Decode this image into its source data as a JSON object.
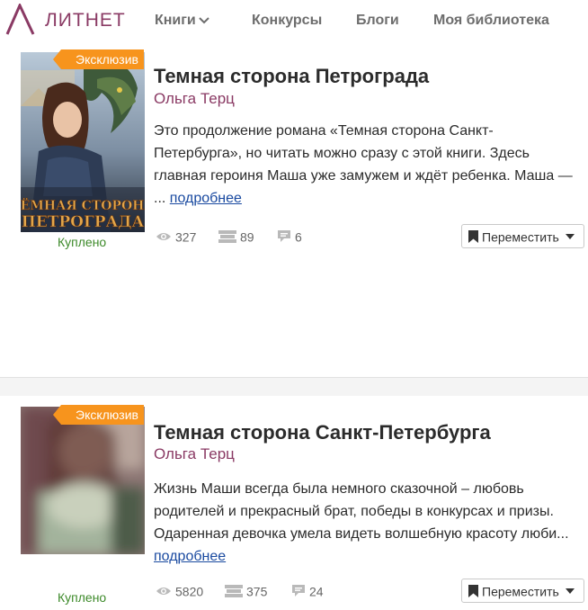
{
  "nav": {
    "logo": "ЛИТНЕТ",
    "books": "Книги",
    "contests": "Конкурсы",
    "blogs": "Блоги",
    "library": "Моя библиотека"
  },
  "books": [
    {
      "badge": "Эксклюзив",
      "status": "Куплено",
      "title": "Темная сторона Петрограда",
      "author": "Ольга Терц",
      "description": "Это продолжение романа «Темная сторона Санкт-Петербурга», но читать можно сразу с этой книги. Здесь главная героиня Маша уже замужем и ждёт ребенка. Маша — ... ",
      "more": "подробнее",
      "views": "327",
      "libraries": "89",
      "comments": "6",
      "move_label": "Переместить",
      "cover_text": [
        "ТЁМНАЯ СТОРОНА",
        "ПЕТРОГРАДА"
      ]
    },
    {
      "badge": "Эксклюзив",
      "status": "Куплено",
      "title": "Темная сторона Санкт-Петербурга",
      "author": "Ольга Терц",
      "description": "Жизнь Маши всегда была немного сказочной – любовь родителей и прекрасный брат, победы в конкурсах и призы. Одаренная девочка умела видеть волшебную красоту люби... ",
      "more": "подробнее",
      "views": "5820",
      "libraries": "375",
      "comments": "24",
      "move_label": "Переместить"
    }
  ],
  "colors": {
    "brand": "#8a3a64",
    "badge": "#f7941d",
    "bought": "#3d8a2a",
    "link": "#1a4aa0"
  },
  "icons": [
    "logo-icon",
    "chevron-down-icon",
    "eye-icon",
    "library-icon",
    "comment-icon",
    "bookmark-icon",
    "caret-down-icon"
  ]
}
